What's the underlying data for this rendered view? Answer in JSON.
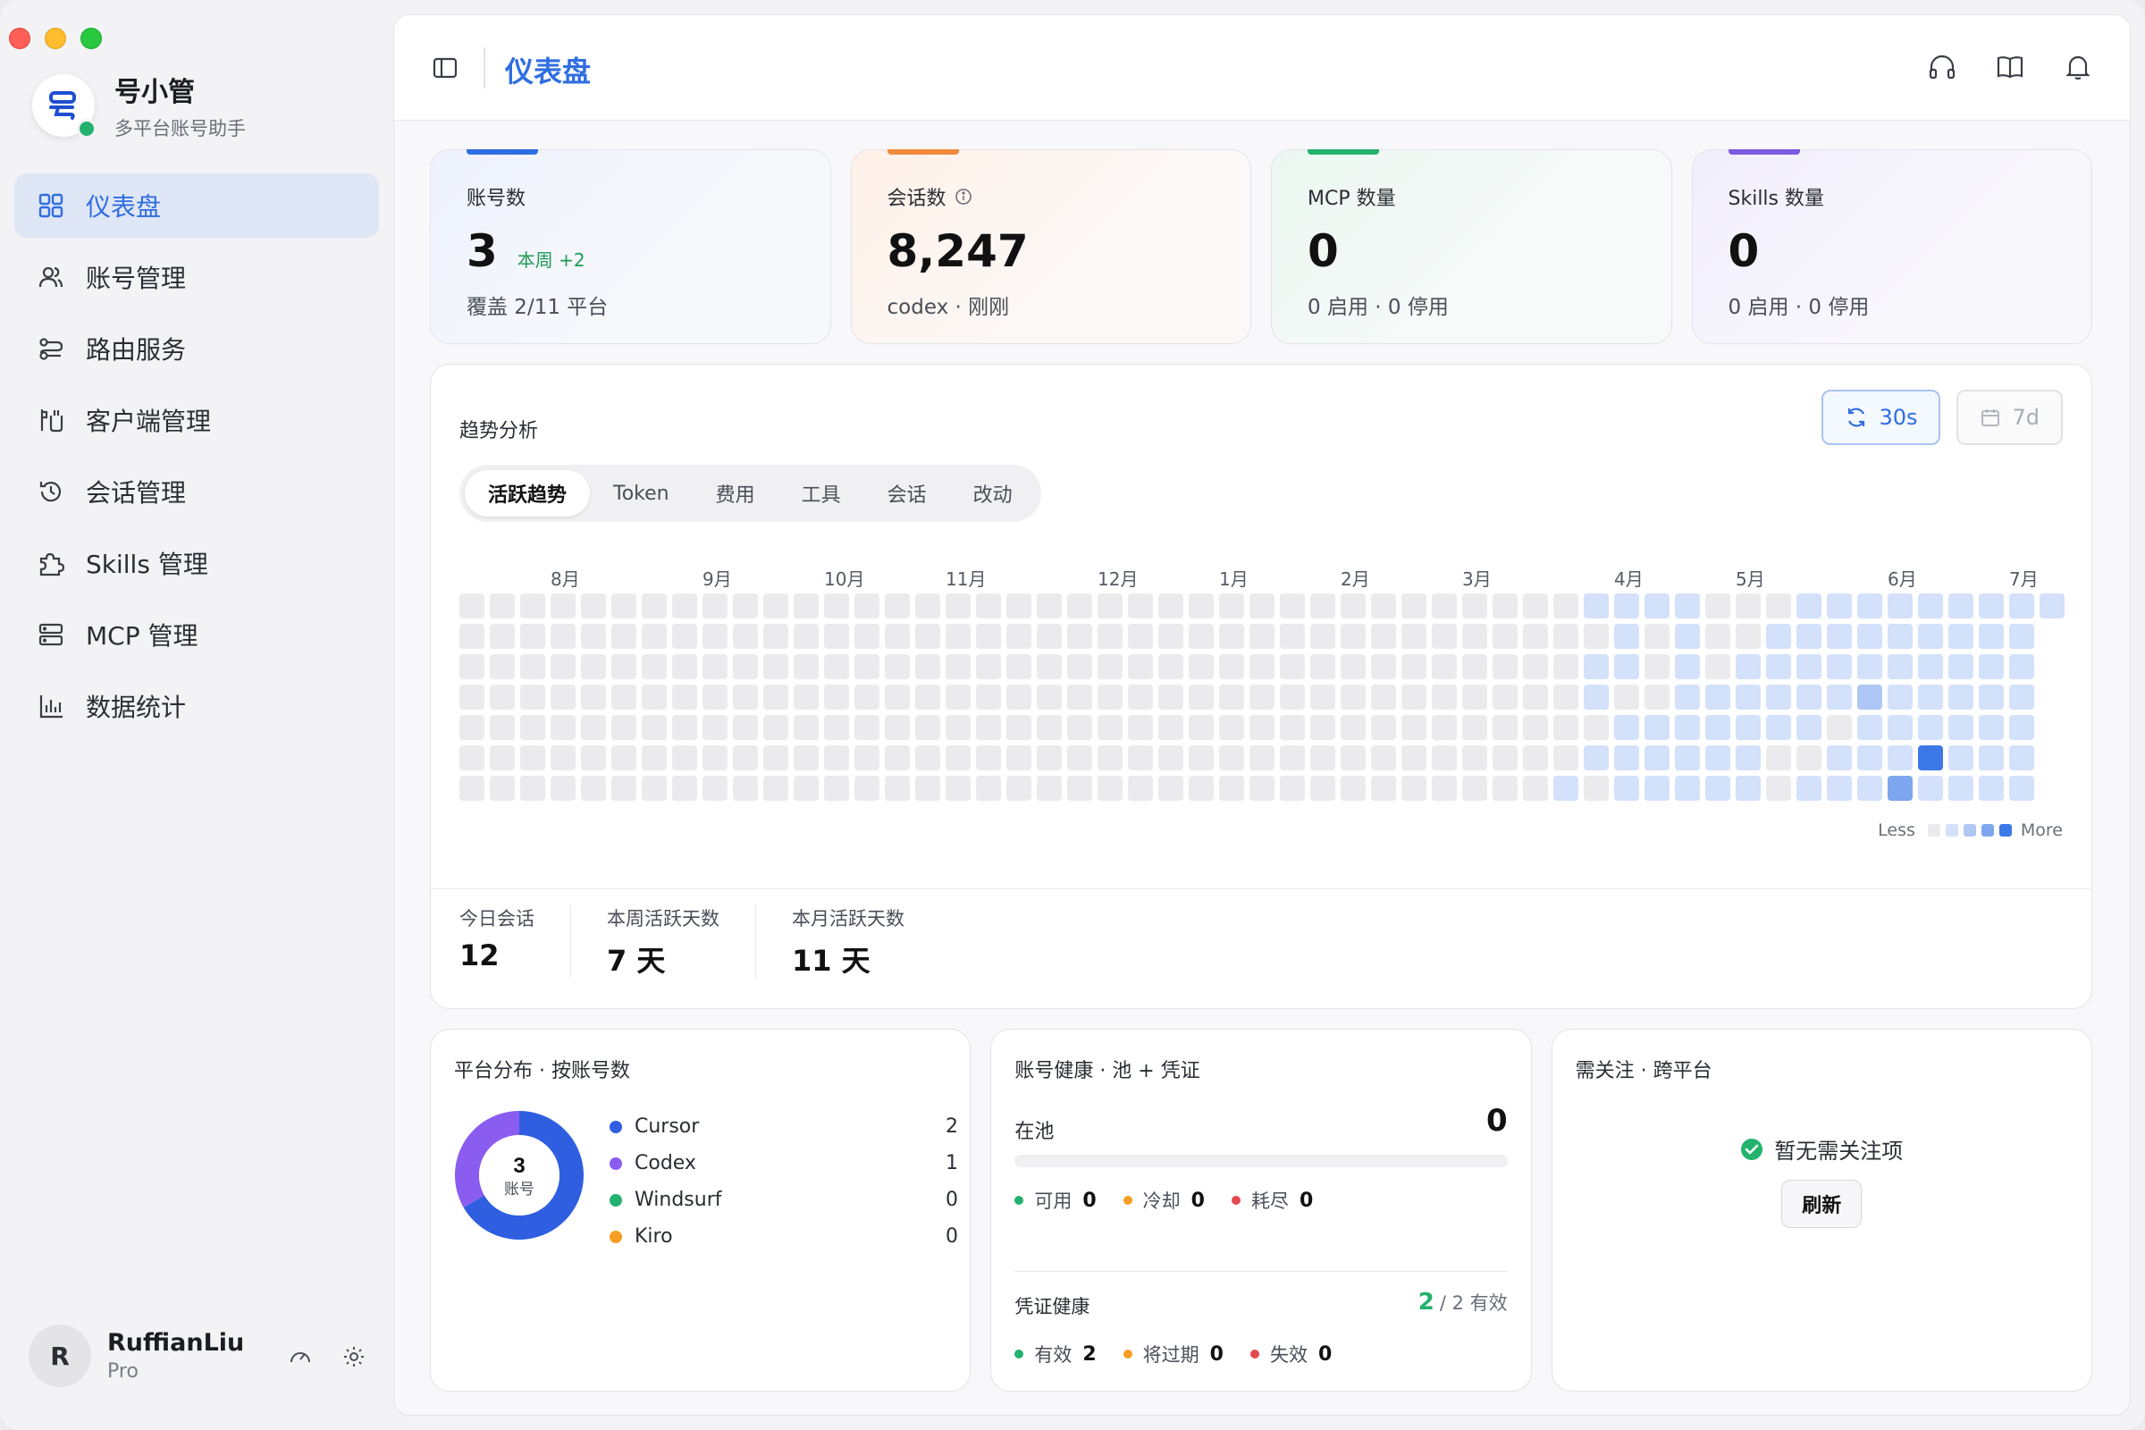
{
  "app": {
    "name": "号小管",
    "subtitle": "多平台账号助手"
  },
  "sidebar": {
    "items": [
      {
        "label": "仪表盘",
        "icon": "grid-icon",
        "active": true
      },
      {
        "label": "账号管理",
        "icon": "users-icon"
      },
      {
        "label": "路由服务",
        "icon": "route-icon"
      },
      {
        "label": "客户端管理",
        "icon": "client-icon"
      },
      {
        "label": "会话管理",
        "icon": "history-icon"
      },
      {
        "label": "Skills 管理",
        "icon": "puzzle-icon"
      },
      {
        "label": "MCP 管理",
        "icon": "server-icon"
      },
      {
        "label": "数据统计",
        "icon": "bar-chart-icon"
      }
    ]
  },
  "user": {
    "initial": "R",
    "name": "RuffianLiu",
    "plan": "Pro"
  },
  "header": {
    "title": "仪表盘"
  },
  "stats": [
    {
      "label": "账号数",
      "value": "3",
      "delta": "本周 +2",
      "sub": "覆盖 2/11 平台",
      "accent": "#2f6ee0"
    },
    {
      "label": "会话数",
      "value": "8,247",
      "sub": "codex · 刚刚",
      "accent": "#f08a3c"
    },
    {
      "label": "MCP 数量",
      "value": "0",
      "sub": "0 启用 · 0 停用",
      "accent": "#23b26d"
    },
    {
      "label": "Skills 数量",
      "value": "0",
      "sub": "0 启用 · 0 停用",
      "accent": "#7b5be0"
    }
  ],
  "trend": {
    "title": "趋势分析",
    "refresh_label": "30s",
    "range_label": "7d",
    "tabs": [
      "活跃趋势",
      "Token",
      "费用",
      "工具",
      "会话",
      "改动"
    ],
    "active_tab": 0,
    "months": [
      "8月",
      "9月",
      "10月",
      "11月",
      "12月",
      "1月",
      "2月",
      "3月",
      "4月",
      "5月",
      "6月",
      "7月"
    ],
    "legend_less": "Less",
    "legend_more": "More",
    "heat_colors": [
      "#ebebed",
      "#d3e1fa",
      "#aec7f4",
      "#7ea6ee",
      "#3c78e6"
    ],
    "heatmap_levels": [
      "00000000000000000000000000000000000001111000111111111",
      "0000000000000000000000000000000000000010100111111111",
      "0000000000000000000000000000000000000110101111111111",
      "0000000000000000000000000000000000000100111111211111",
      "0000000000000000000000000000000000000011111110111111",
      "0000000000000000000000000000000000000111111001114111",
      "0000000000000000000000000000000000001011111011131111"
    ],
    "mini_stats": [
      {
        "label": "今日会话",
        "value": "12"
      },
      {
        "label": "本周活跃天数",
        "value": "7 天"
      },
      {
        "label": "本月活跃天数",
        "value": "11 天"
      }
    ]
  },
  "platforms": {
    "title": "平台分布 · 按账号数",
    "center_value": "3",
    "center_label": "账号",
    "items": [
      {
        "name": "Cursor",
        "count": 2,
        "color": "#2f5fe0"
      },
      {
        "name": "Codex",
        "count": 1,
        "color": "#8b5cf0"
      },
      {
        "name": "Windsurf",
        "count": 0,
        "color": "#23b26d"
      },
      {
        "name": "Kiro",
        "count": 0,
        "color": "#f59e24"
      }
    ]
  },
  "health": {
    "title": "账号健康 · 池 + 凭证",
    "pool_label": "在池",
    "pool_value": "0",
    "pool_states": [
      {
        "label": "可用",
        "value": "0",
        "color": "#23b26d"
      },
      {
        "label": "冷却",
        "value": "0",
        "color": "#f59e24"
      },
      {
        "label": "耗尽",
        "value": "0",
        "color": "#e5484d"
      }
    ],
    "cred_label": "凭证健康",
    "cred_valid": "2",
    "cred_total": "/ 2 有效",
    "cred_states": [
      {
        "label": "有效",
        "value": "2",
        "color": "#23b26d"
      },
      {
        "label": "将过期",
        "value": "0",
        "color": "#f59e24"
      },
      {
        "label": "失效",
        "value": "0",
        "color": "#e5484d"
      }
    ]
  },
  "attention": {
    "title": "需关注 · 跨平台",
    "empty_text": "暂无需关注项",
    "refresh_label": "刷新"
  }
}
